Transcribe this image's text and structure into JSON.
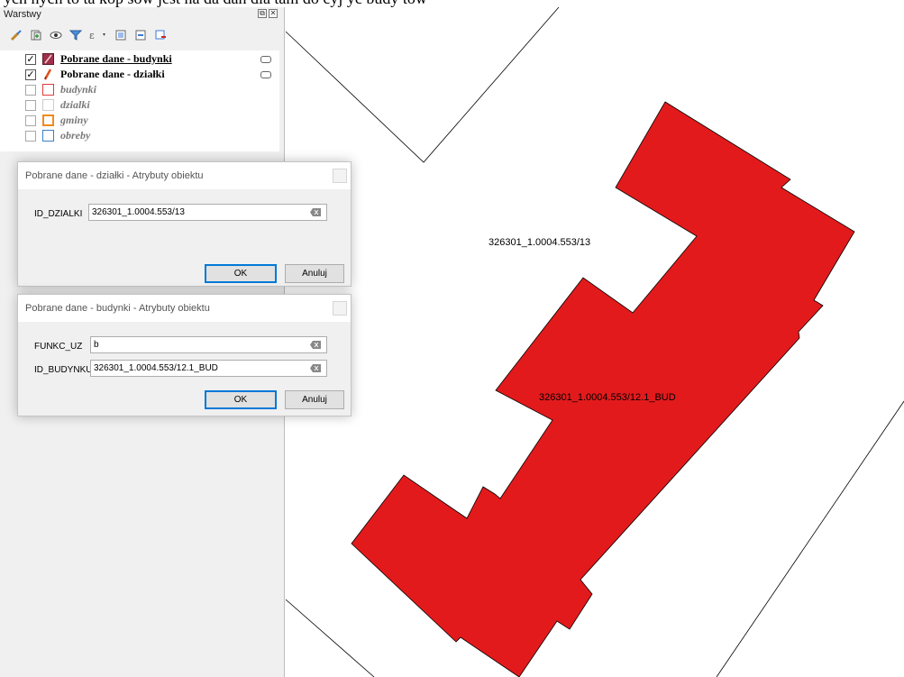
{
  "banner_text": "ych nych to ta kop sów jest na da dan dla tam do cyj yc budy tów",
  "layers_panel": {
    "title": "Warstwy",
    "toolbar_icons": [
      "style-brush-icon",
      "add-group-icon",
      "eye-icon",
      "filter-icon",
      "expression-filter-icon",
      "expand-all-icon",
      "collapse-all-icon",
      "remove-layer-icon"
    ],
    "layers": [
      {
        "name": "Pobrane dane - budynki",
        "checked": true,
        "active": true,
        "enabled": true,
        "symbol_color": "#a0304a",
        "editing": true
      },
      {
        "name": "Pobrane dane - działki",
        "checked": true,
        "active": false,
        "enabled": true,
        "symbol_color": "#e05020",
        "editing": true
      },
      {
        "name": "budynki",
        "checked": false,
        "active": false,
        "enabled": false,
        "symbol_color": "#e23b3b",
        "editing": false
      },
      {
        "name": "dzialki",
        "checked": false,
        "active": false,
        "enabled": false,
        "symbol_color": "#cccccc",
        "editing": false
      },
      {
        "name": "gminy",
        "checked": false,
        "active": false,
        "enabled": false,
        "symbol_color": "#f08a1c",
        "editing": false
      },
      {
        "name": "obreby",
        "checked": false,
        "active": false,
        "enabled": false,
        "symbol_color": "#3a7ec8",
        "editing": false
      }
    ]
  },
  "dialog_dzialki": {
    "title": "Pobrane dane - działki - Atrybuty obiektu",
    "fields": [
      {
        "label": "ID_DZIALKI",
        "value": "326301_1.0004.553/13"
      }
    ],
    "ok_label": "OK",
    "cancel_label": "Anuluj"
  },
  "dialog_budynki": {
    "title": "Pobrane dane - budynki - Atrybuty obiektu",
    "fields": [
      {
        "label": "FUNKC_UZ",
        "value": "b"
      },
      {
        "label": "ID_BUDYNKU",
        "value": "326301_1.0004.553/12.1_BUD"
      }
    ],
    "ok_label": "OK",
    "cancel_label": "Anuluj"
  },
  "map": {
    "parcel_label": "326301_1.0004.553/13",
    "building_label": "326301_1.0004.553/12.1_BUD",
    "building_fill": "#e31a1c",
    "line_color": "#000000"
  }
}
